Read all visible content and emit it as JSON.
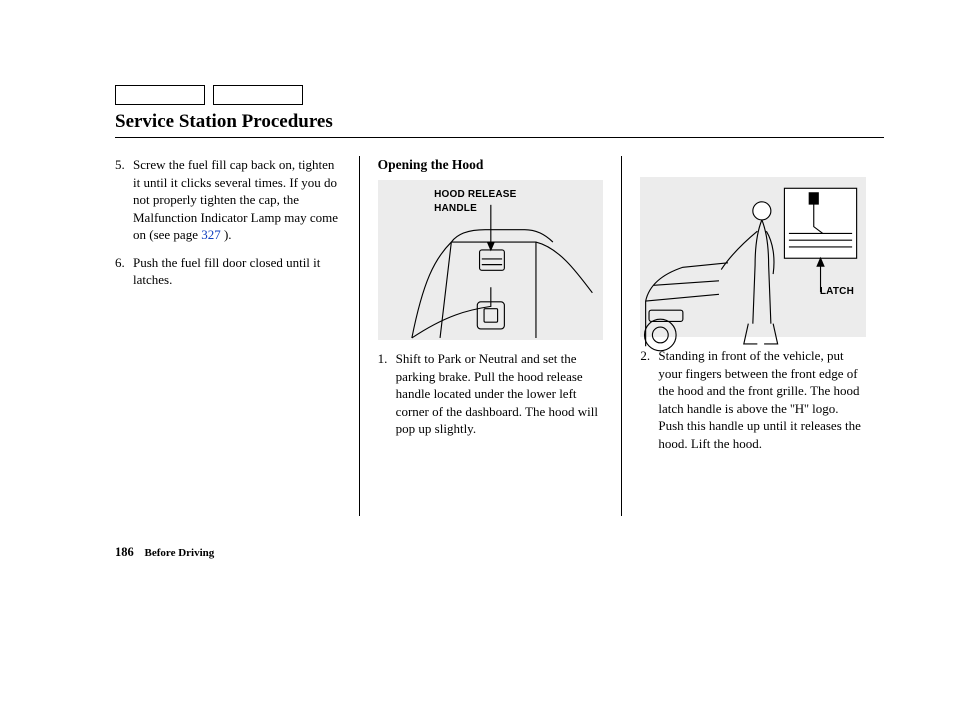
{
  "title": "Service Station Procedures",
  "col1": {
    "step5": {
      "num": "5.",
      "text_a": "Screw the fuel fill cap back on, tighten it until it clicks several times. If you do not properly tighten the cap, the Malfunction Indicator Lamp may come on (see page ",
      "page_ref": "327",
      "text_b": " )."
    },
    "step6": {
      "num": "6.",
      "text": "Push the fuel fill door closed until it latches."
    }
  },
  "col2": {
    "subhead": "Opening the Hood",
    "fig_label": "HOOD RELEASE HANDLE",
    "step1": {
      "num": "1.",
      "text": "Shift to Park or Neutral and set the parking brake. Pull the hood release handle located under the lower left corner of the dashboard. The hood will pop up slightly."
    }
  },
  "col3": {
    "fig_label": "LATCH",
    "step2": {
      "num": "2.",
      "text": "Standing in front of the vehicle, put your fingers between the front edge of the hood and the front grille. The hood latch handle is above the ''H'' logo. Push this handle up until it releases the hood. Lift the hood."
    }
  },
  "footer": {
    "page_num": "186",
    "section": "Before Driving"
  }
}
